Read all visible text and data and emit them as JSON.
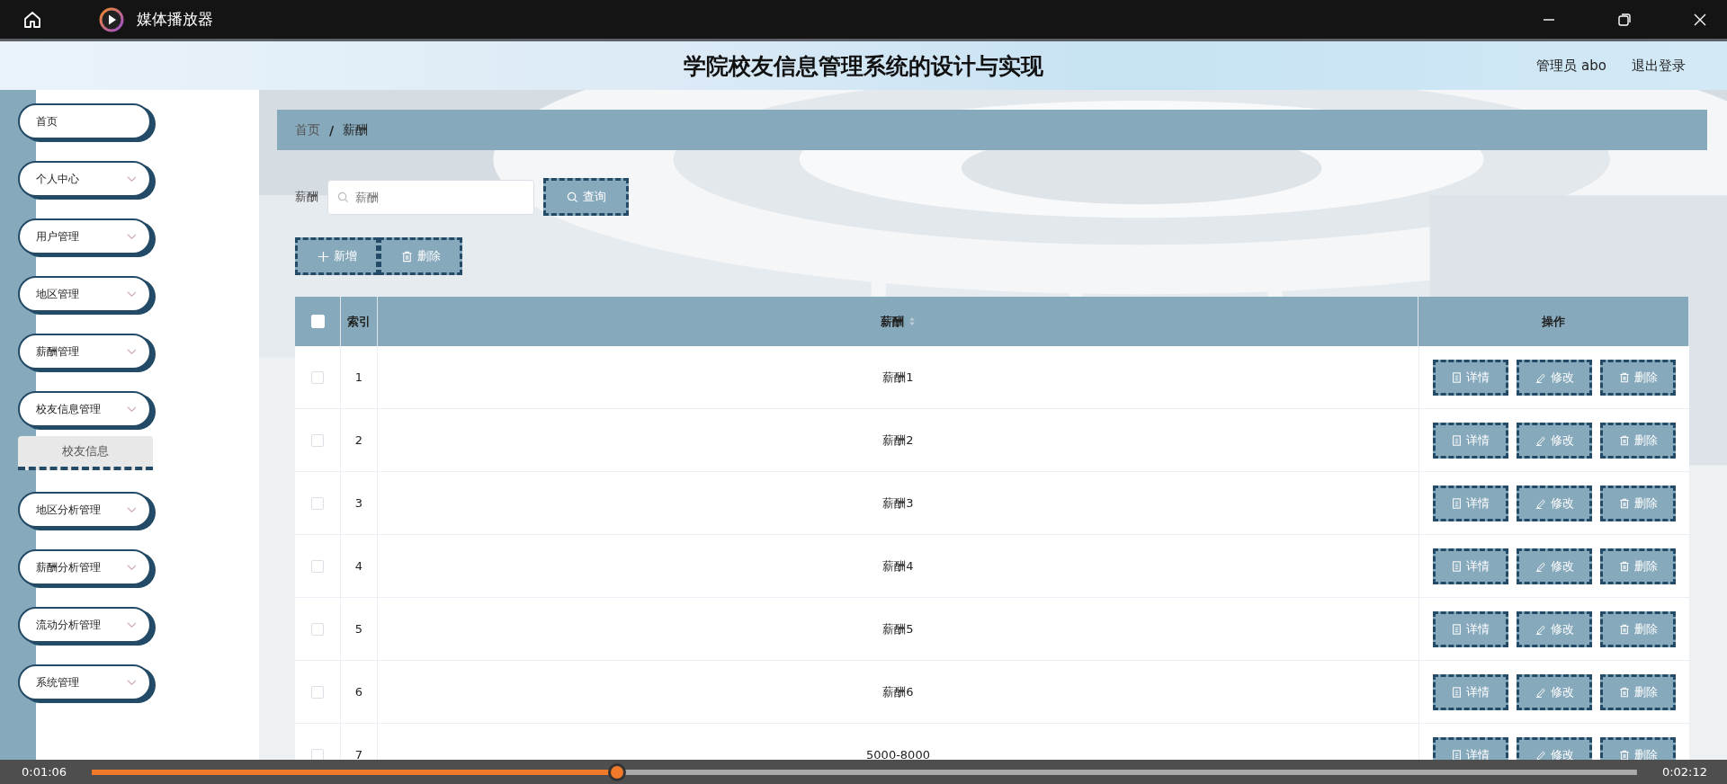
{
  "player": {
    "title": "媒体播放器",
    "elapsed": "0:01:06",
    "duration": "0:02:12",
    "level": 0.34
  },
  "header": {
    "title": "学院校友信息管理系统的设计与实现",
    "user": "管理员 abo",
    "logout": "退出登录"
  },
  "sidebar": {
    "items": [
      {
        "label": "首页",
        "kind": "link"
      },
      {
        "label": "个人中心",
        "kind": "submenu"
      },
      {
        "label": "用户管理",
        "kind": "submenu"
      },
      {
        "label": "地区管理",
        "kind": "submenu"
      },
      {
        "label": "薪酬管理",
        "kind": "submenu"
      },
      {
        "label": "校友信息管理",
        "kind": "submenu",
        "children": [
          {
            "label": "校友信息",
            "selected": true
          }
        ]
      },
      {
        "label": "地区分析管理",
        "kind": "submenu"
      },
      {
        "label": "薪酬分析管理",
        "kind": "submenu"
      },
      {
        "label": "流动分析管理",
        "kind": "submenu"
      },
      {
        "label": "系统管理",
        "kind": "submenu"
      }
    ]
  },
  "breadcrumb": {
    "items": [
      "首页",
      "薪酬"
    ],
    "separator": "/"
  },
  "search": {
    "label": "薪酬",
    "placeholder": "薪酬",
    "button": "查询"
  },
  "toolbar": [
    {
      "kind": "add",
      "label": "新增"
    },
    {
      "kind": "delete",
      "label": "删除"
    }
  ],
  "table": {
    "select_all": {
      "checked": false
    },
    "columns": [
      {
        "label": "索引",
        "sortable": false
      },
      {
        "label": "薪酬",
        "sortable": true
      },
      {
        "label": "操作",
        "sortable": false
      }
    ],
    "rows": [
      {
        "checked": false,
        "index": "1",
        "value": "薪酬1",
        "actions": [
          {
            "kind": "detail",
            "label": "详情"
          },
          {
            "kind": "edit",
            "label": "修改"
          },
          {
            "kind": "delete",
            "label": "删除"
          }
        ]
      },
      {
        "checked": false,
        "index": "2",
        "value": "薪酬2",
        "actions": [
          {
            "kind": "detail",
            "label": "详情"
          },
          {
            "kind": "edit",
            "label": "修改"
          },
          {
            "kind": "delete",
            "label": "删除"
          }
        ]
      },
      {
        "checked": false,
        "index": "3",
        "value": "薪酬3",
        "actions": [
          {
            "kind": "detail",
            "label": "详情"
          },
          {
            "kind": "edit",
            "label": "修改"
          },
          {
            "kind": "delete",
            "label": "删除"
          }
        ]
      },
      {
        "checked": false,
        "index": "4",
        "value": "薪酬4",
        "actions": [
          {
            "kind": "detail",
            "label": "详情"
          },
          {
            "kind": "edit",
            "label": "修改"
          },
          {
            "kind": "delete",
            "label": "删除"
          }
        ]
      },
      {
        "checked": false,
        "index": "5",
        "value": "薪酬5",
        "actions": [
          {
            "kind": "detail",
            "label": "详情"
          },
          {
            "kind": "edit",
            "label": "修改"
          },
          {
            "kind": "delete",
            "label": "删除"
          }
        ]
      },
      {
        "checked": false,
        "index": "6",
        "value": "薪酬6",
        "actions": [
          {
            "kind": "detail",
            "label": "详情"
          },
          {
            "kind": "edit",
            "label": "修改"
          },
          {
            "kind": "delete",
            "label": "删除"
          }
        ]
      },
      {
        "checked": false,
        "index": "7",
        "value": "5000-8000",
        "actions": [
          {
            "kind": "detail",
            "label": "详情"
          },
          {
            "kind": "edit",
            "label": "修改"
          },
          {
            "kind": "delete",
            "label": "删除"
          }
        ]
      }
    ]
  }
}
